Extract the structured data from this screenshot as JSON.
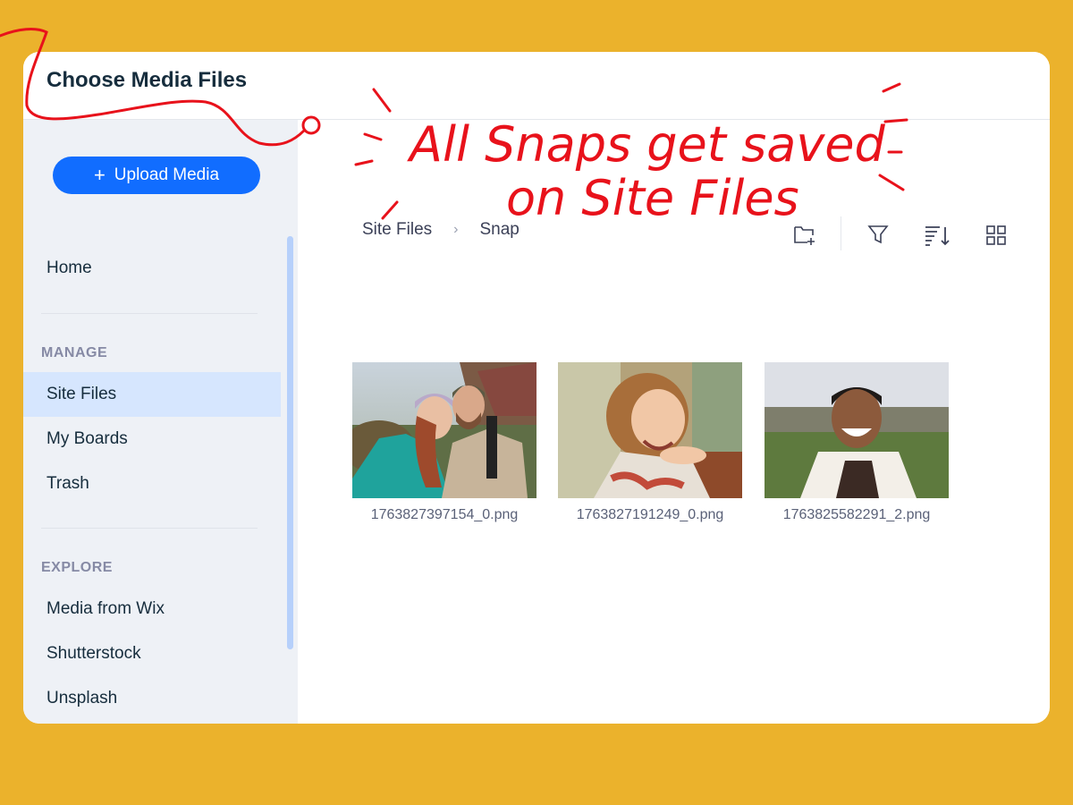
{
  "dialog": {
    "title": "Choose Media Files"
  },
  "sidebar": {
    "upload_label": "Upload Media",
    "home_label": "Home",
    "manage_label": "MANAGE",
    "manage_items": [
      {
        "label": "Site Files",
        "selected": true
      },
      {
        "label": "My Boards",
        "selected": false
      },
      {
        "label": "Trash",
        "selected": false
      }
    ],
    "explore_label": "EXPLORE",
    "explore_items": [
      {
        "label": "Media from Wix"
      },
      {
        "label": "Shutterstock"
      },
      {
        "label": "Unsplash"
      }
    ]
  },
  "breadcrumb": {
    "items": [
      "Site Files",
      "Snap"
    ],
    "separator": "›"
  },
  "toolbar": {
    "icons": [
      "new-folder-icon",
      "filter-icon",
      "sort-icon",
      "grid-view-icon"
    ]
  },
  "files": [
    {
      "name": "1763827397154_0.png",
      "subject": "couple-selfie"
    },
    {
      "name": "1763827191249_0.png",
      "subject": "smiling-girl"
    },
    {
      "name": "1763825582291_2.png",
      "subject": "smiling-man"
    }
  ],
  "annotation": {
    "line1": "All Snaps get saved",
    "line2": "on Site Files",
    "color": "#E8121B"
  },
  "colors": {
    "background": "#EBB22C",
    "accent": "#116DFF",
    "sidebar": "#EEF1F6",
    "selected": "#D6E6FE"
  }
}
